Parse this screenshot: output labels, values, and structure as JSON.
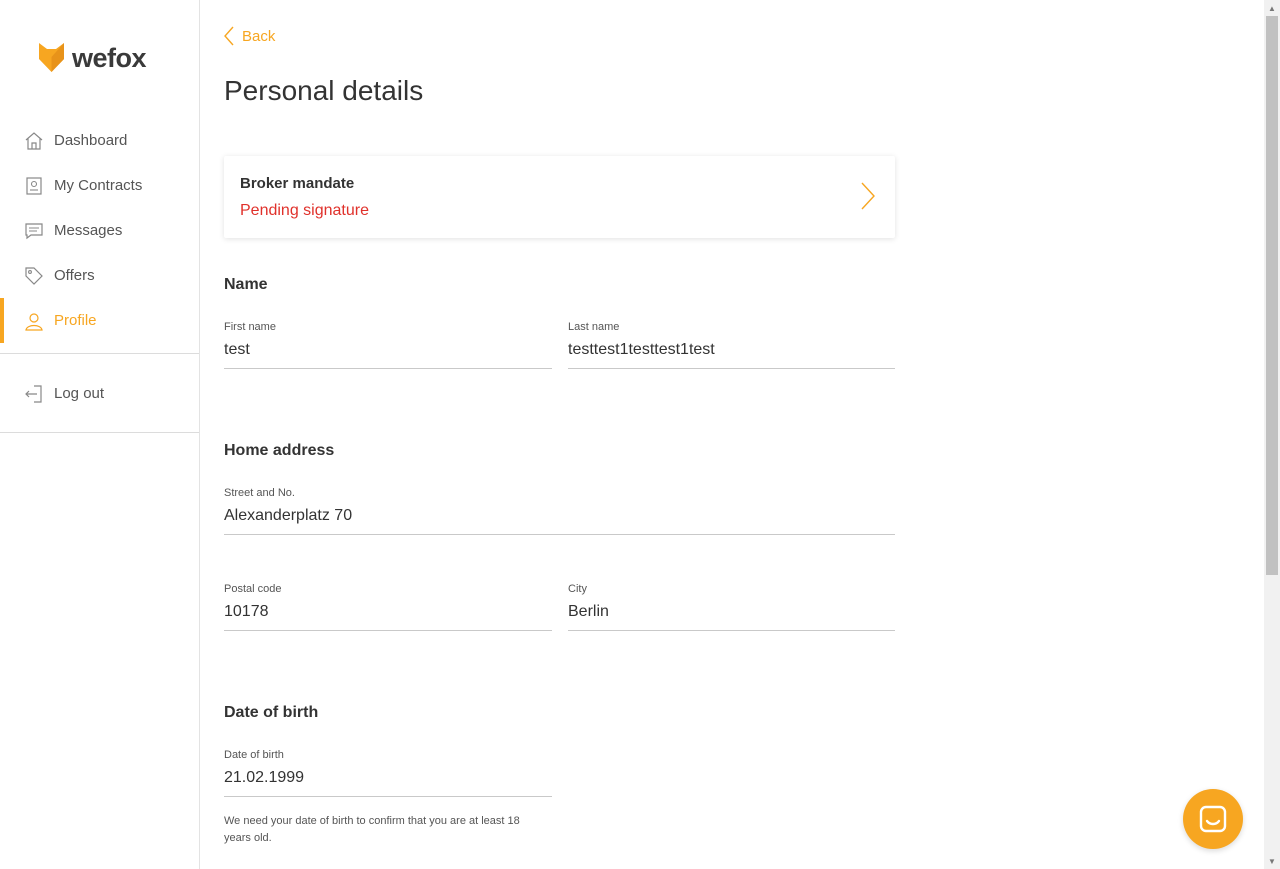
{
  "brand": {
    "name": "wefox",
    "accent": "#f7a621",
    "error": "#e0312b"
  },
  "sidebar": {
    "items": [
      {
        "label": "Dashboard",
        "icon": "home-icon"
      },
      {
        "label": "My Contracts",
        "icon": "contract-icon"
      },
      {
        "label": "Messages",
        "icon": "message-icon"
      },
      {
        "label": "Offers",
        "icon": "tag-icon"
      },
      {
        "label": "Profile",
        "icon": "user-icon",
        "active": true
      }
    ],
    "logout": {
      "label": "Log out",
      "icon": "logout-icon"
    }
  },
  "main": {
    "back_label": "Back",
    "title": "Personal details",
    "mandate": {
      "title": "Broker mandate",
      "status": "Pending signature"
    },
    "name_section": {
      "title": "Name",
      "first_name": {
        "label": "First name",
        "value": "test"
      },
      "last_name": {
        "label": "Last name",
        "value": "testtest1testtest1test"
      }
    },
    "address_section": {
      "title": "Home address",
      "street": {
        "label": "Street and No.",
        "value": "Alexanderplatz 70"
      },
      "postal": {
        "label": "Postal code",
        "value": "10178"
      },
      "city": {
        "label": "City",
        "value": "Berlin"
      }
    },
    "dob_section": {
      "title": "Date of birth",
      "dob": {
        "label": "Date of birth",
        "value": "21.02.1999"
      },
      "hint": "We need your date of birth to confirm that you are at least 18 years old."
    }
  },
  "chat": {
    "icon": "chat-icon"
  }
}
